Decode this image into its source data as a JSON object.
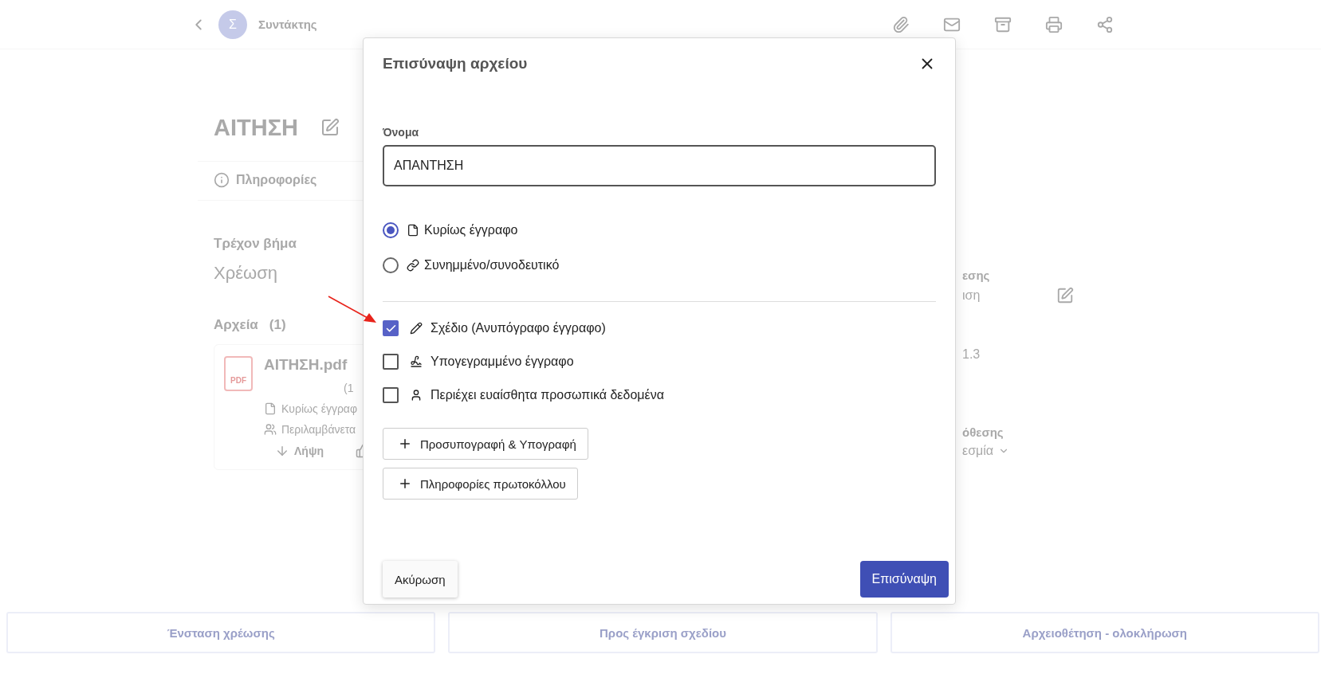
{
  "top_bar": {
    "avatar_letter": "Σ",
    "role": "Συντάκτης"
  },
  "document": {
    "title": "ΑΙΤΗΣΗ",
    "tabs": [
      {
        "label": "Πληροφορίες",
        "selected": false
      }
    ],
    "current_step": {
      "label": "Τρέχον βήμα",
      "value": "Χρέωση"
    },
    "files": {
      "heading": "Αρχεία",
      "count": "(1)",
      "items": [
        {
          "name": "ΑΙΤΗΣΗ.pdf",
          "file_type": "PDF",
          "size": "(1",
          "role": "Κυρίως έγγραφ",
          "participants": "Περιλαμβάνετα",
          "download": "Λήψη"
        }
      ]
    }
  },
  "right_panel": [
    {
      "kind": "heading",
      "text": "εσης"
    },
    {
      "kind": "editable",
      "text": "ιση"
    },
    {
      "kind": "value",
      "text": "1.3"
    },
    {
      "kind": "heading",
      "text": "όθεσης"
    },
    {
      "kind": "dropdown",
      "text": "εσμία"
    }
  ],
  "actions": [
    "Ένσταση χρέωσης",
    "Προς έγκριση σχεδίου",
    "Αρχειοθέτηση - ολοκλήρωση"
  ],
  "dialog": {
    "title": "Επισύναψη αρχείου",
    "name_field": {
      "label": "Όνομα",
      "value": "ΑΠΑΝΤΗΣΗ"
    },
    "doc_types": [
      {
        "kind": "main",
        "label": "Κυρίως έγγραφο",
        "selected": true
      },
      {
        "kind": "attachment",
        "label": "Συνημμένο/συνοδευτικό",
        "selected": false
      }
    ],
    "flags": [
      {
        "kind": "draft",
        "label": "Σχέδιο (Ανυπόγραφο έγγραφο)",
        "checked": true
      },
      {
        "kind": "signed",
        "label": "Υπογεγραμμένο έγγραφο",
        "checked": false
      },
      {
        "kind": "personal",
        "label": "Περιέχει ευαίσθητα προσωπικά δεδομένα",
        "checked": false
      }
    ],
    "add_buttons": [
      "Προσυπογραφή & Υπογραφή",
      "Πληροφορίες πρωτοκόλλου"
    ],
    "cancel": "Ακύρωση",
    "submit": "Επισύναψη"
  }
}
